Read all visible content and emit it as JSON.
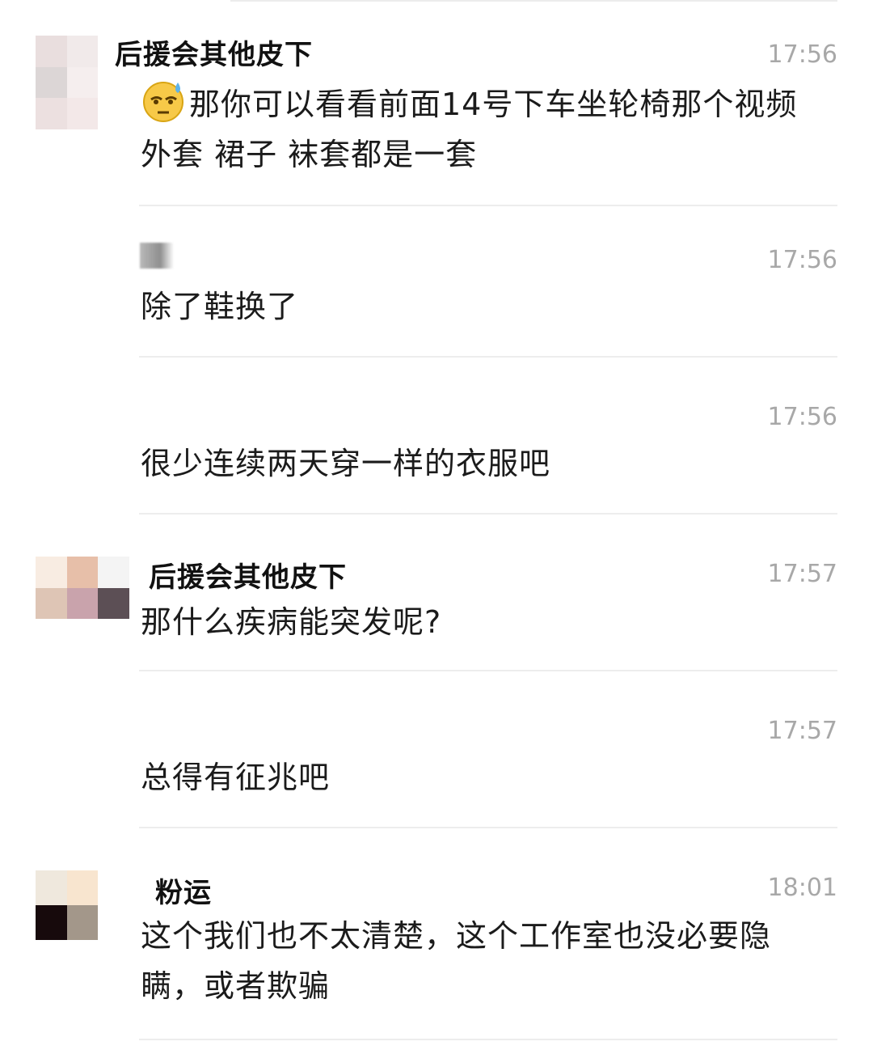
{
  "messages": [
    {
      "sender": "后援会其他皮下",
      "time": "17:56",
      "text": "那你可以看看前面14号下车坐轮椅那个视频 外套 裙子 袜套都是一套",
      "emoji": "sweat-face-icon"
    },
    {
      "sender": "",
      "time": "17:56",
      "text": "除了鞋换了"
    },
    {
      "sender": "",
      "time": "17:56",
      "text": "很少连续两天穿一样的衣服吧"
    },
    {
      "sender": "后援会其他皮下",
      "time": "17:57",
      "text": "那什么疾病能突发呢?"
    },
    {
      "sender": "",
      "time": "17:57",
      "text": "总得有征兆吧"
    },
    {
      "sender": "粉运",
      "time": "18:01",
      "text": "这个我们也不太清楚，这个工作室也没必要隐瞒，或者欺骗"
    }
  ],
  "colors": {
    "timestamp": "#a8a8a8",
    "divider": "#ededed",
    "text": "#1b1b1b"
  }
}
